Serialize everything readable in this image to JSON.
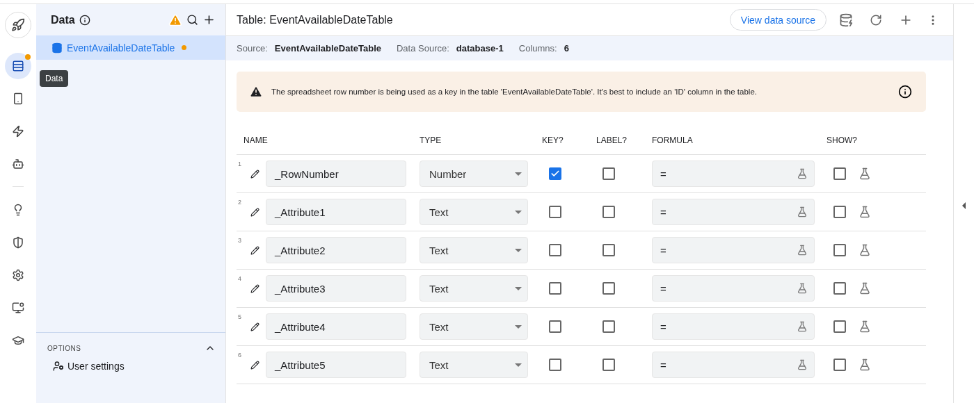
{
  "rail": {
    "items": [
      {
        "selected": true,
        "badge": true
      },
      {
        "selected": false,
        "badge": false
      },
      {
        "selected": false,
        "badge": false
      },
      {
        "selected": false,
        "badge": false
      },
      {
        "selected": false,
        "badge": false
      },
      {
        "selected": false,
        "badge": false
      },
      {
        "selected": false,
        "badge": false
      },
      {
        "selected": false,
        "badge": false
      },
      {
        "selected": false,
        "badge": false
      }
    ],
    "tooltip": "Data"
  },
  "sidebar": {
    "title": "Data",
    "items": [
      {
        "label": "EventAvailableDateTable",
        "selected": true,
        "modified": true
      }
    ],
    "options": {
      "heading": "OPTIONS",
      "expanded": true,
      "items": [
        {
          "label": "User settings"
        }
      ]
    }
  },
  "header": {
    "title": "Table: EventAvailableDateTable",
    "button": "View data source"
  },
  "info": [
    {
      "label": "Source:",
      "value": "EventAvailableDateTable"
    },
    {
      "label": "Data Source:",
      "value": "database-1"
    },
    {
      "label": "Columns:",
      "value": "6"
    }
  ],
  "warning": "The spreadsheet row number is being used as a key in the table 'EventAvailableDateTable'. It's best to include an 'ID' column in the table.",
  "table": {
    "columns": [
      "NAME",
      "TYPE",
      "KEY?",
      "LABEL?",
      "FORMULA",
      "SHOW?"
    ],
    "rows": [
      {
        "number": "1",
        "name": "_RowNumber",
        "type": "Number",
        "key": true,
        "label": false,
        "formula": "=",
        "show": false
      },
      {
        "number": "2",
        "name": "_Attribute1",
        "type": "Text",
        "key": false,
        "label": false,
        "formula": "=",
        "show": false
      },
      {
        "number": "3",
        "name": "_Attribute2",
        "type": "Text",
        "key": false,
        "label": false,
        "formula": "=",
        "show": false
      },
      {
        "number": "4",
        "name": "_Attribute3",
        "type": "Text",
        "key": false,
        "label": false,
        "formula": "=",
        "show": false
      },
      {
        "number": "5",
        "name": "_Attribute4",
        "type": "Text",
        "key": false,
        "label": false,
        "formula": "=",
        "show": false
      },
      {
        "number": "6",
        "name": "_Attribute5",
        "type": "Text",
        "key": false,
        "label": false,
        "formula": "=",
        "show": false
      }
    ]
  }
}
